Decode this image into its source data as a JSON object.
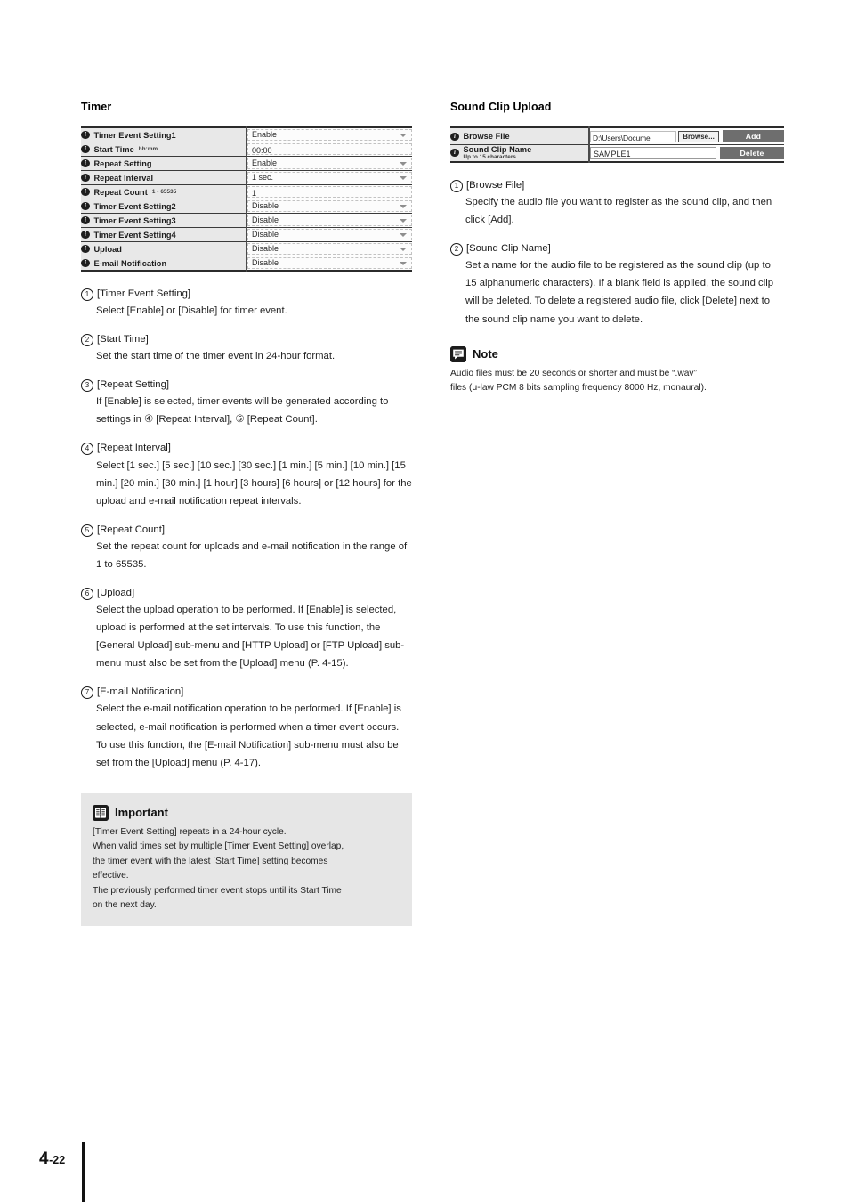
{
  "left": {
    "heading": "Timer",
    "table": {
      "rows": [
        {
          "label": "Timer Event Setting1",
          "hint": "",
          "control": "select",
          "value": "Enable"
        },
        {
          "label": "Start Time",
          "hint": "hh:mm",
          "control": "input",
          "value": "00:00"
        },
        {
          "label": "Repeat Setting",
          "hint": "",
          "control": "select",
          "value": "Enable"
        },
        {
          "label": "Repeat Interval",
          "hint": "",
          "control": "select",
          "value": "1 sec."
        },
        {
          "label": "Repeat Count",
          "hint": "1 - 65535",
          "control": "input",
          "value": "1"
        },
        {
          "label": "Timer Event Setting2",
          "hint": "",
          "control": "select",
          "value": "Disable"
        },
        {
          "label": "Timer Event Setting3",
          "hint": "",
          "control": "select",
          "value": "Disable"
        },
        {
          "label": "Timer Event Setting4",
          "hint": "",
          "control": "select",
          "value": "Disable"
        },
        {
          "label": "Upload",
          "hint": "",
          "control": "select",
          "value": "Disable"
        },
        {
          "label": "E-mail Notification",
          "hint": "",
          "control": "select",
          "value": "Disable"
        }
      ]
    },
    "items": [
      {
        "num": "①",
        "title": "[Timer Event Setting]",
        "body": "Select [Enable] or [Disable] for timer event."
      },
      {
        "num": "②",
        "title": "[Start Time]",
        "body": "Set the start time of the timer event in 24-hour format."
      },
      {
        "num": "③",
        "title": "[Repeat Setting]",
        "body": "If [Enable] is selected, timer events will be generated according to settings in ④ [Repeat Interval], ⑤ [Repeat Count]."
      },
      {
        "num": "④",
        "title": "[Repeat Interval]",
        "body": "Select [1 sec.] [5 sec.] [10 sec.] [30 sec.] [1 min.] [5 min.] [10 min.] [15 min.] [20 min.] [30 min.] [1 hour] [3 hours] [6 hours] or [12 hours] for the upload and e-mail notification repeat intervals."
      },
      {
        "num": "⑤",
        "title": "[Repeat Count]",
        "body": "Set the repeat count for uploads and e-mail notification in the range of 1 to 65535."
      },
      {
        "num": "⑥",
        "title": "[Upload]",
        "body": "Select the upload operation to be performed. If [Enable] is selected, upload is performed at the set intervals. To use this function, the [General Upload] sub-menu and [HTTP Upload] or [FTP Upload] sub-menu must also be set from the [Upload] menu (P. 4-15)."
      },
      {
        "num": "⑦",
        "title": "[E-mail Notification]",
        "body": "Select the e-mail notification operation to be performed. If [Enable] is selected, e-mail notification is performed when a timer event occurs. To use this function, the [E-mail Notification] sub-menu must also be set from the [Upload] menu (P. 4-17)."
      }
    ],
    "important": {
      "title": "Important",
      "lines": [
        "[Timer Event Setting] repeats in a 24-hour cycle.",
        "When valid times set by multiple [Timer Event Setting] overlap,",
        "the timer event with the latest [Start Time] setting becomes",
        "effective.",
        "The previously performed timer event stops until its Start Time",
        "on the next day."
      ]
    }
  },
  "right": {
    "heading": "Sound Clip Upload",
    "table": {
      "rows": [
        {
          "label": "Browse File",
          "sub": "",
          "file_path": "D:\\Users\\Docume",
          "browse_label": "Browse...",
          "action_label": "Add"
        },
        {
          "label": "Sound Clip Name",
          "sub": "Up to 15 characters",
          "name_value": "SAMPLE1",
          "action_label": "Delete"
        }
      ]
    },
    "items": [
      {
        "num": "①",
        "title": "[Browse File]",
        "body": "Specify the audio file you want to register as the sound clip, and then click [Add]."
      },
      {
        "num": "②",
        "title": "[Sound Clip Name]",
        "body": "Set a name for the audio file to be registered as the sound clip (up to 15 alphanumeric characters). If a blank field is applied, the sound clip will be deleted. To delete a registered audio file, click [Delete] next to the sound clip name you want to delete."
      }
    ],
    "note": {
      "title": "Note",
      "lines": [
        "Audio files must be 20 seconds or shorter and must be “.wav”",
        "files (μ-law PCM 8 bits sampling frequency 8000 Hz, monaural)."
      ]
    }
  },
  "footer": {
    "chapter": "4",
    "page": "-22"
  }
}
